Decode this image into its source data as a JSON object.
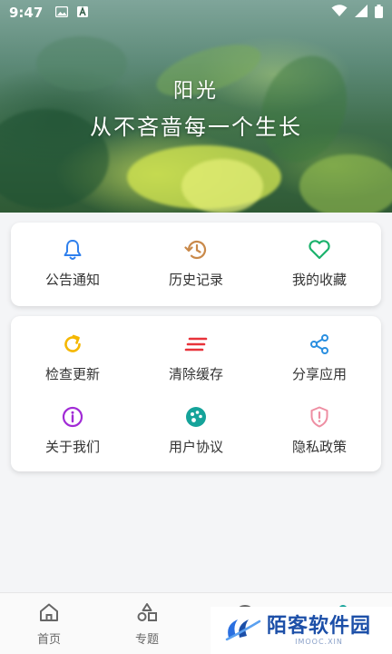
{
  "status_bar": {
    "time": "9:47"
  },
  "hero": {
    "line1": "阳光",
    "line2": "从不吝啬每一个生长"
  },
  "card1": {
    "items": [
      {
        "label": "公告通知",
        "icon": "bell-icon",
        "color": "#2f80ed"
      },
      {
        "label": "历史记录",
        "icon": "history-icon",
        "color": "#c9894a"
      },
      {
        "label": "我的收藏",
        "icon": "heart-icon",
        "color": "#1bb26c"
      }
    ]
  },
  "card2": {
    "items": [
      {
        "label": "检查更新",
        "icon": "refresh-icon",
        "color": "#f5b700"
      },
      {
        "label": "清除缓存",
        "icon": "clear-cache-icon",
        "color": "#e8333a"
      },
      {
        "label": "分享应用",
        "icon": "share-icon",
        "color": "#2a8fe0"
      },
      {
        "label": "关于我们",
        "icon": "info-icon",
        "color": "#a12bd6"
      },
      {
        "label": "用户协议",
        "icon": "palette-icon",
        "color": "#15a39a"
      },
      {
        "label": "隐私政策",
        "icon": "shield-icon",
        "color": "#ee8fa3"
      }
    ]
  },
  "bottom_nav": {
    "items": [
      {
        "label": "首页",
        "icon": "home-icon"
      },
      {
        "label": "专题",
        "icon": "shapes-icon"
      }
    ]
  },
  "watermark": {
    "title": "陌客软件园",
    "sub": "IMOOC.XIN"
  }
}
